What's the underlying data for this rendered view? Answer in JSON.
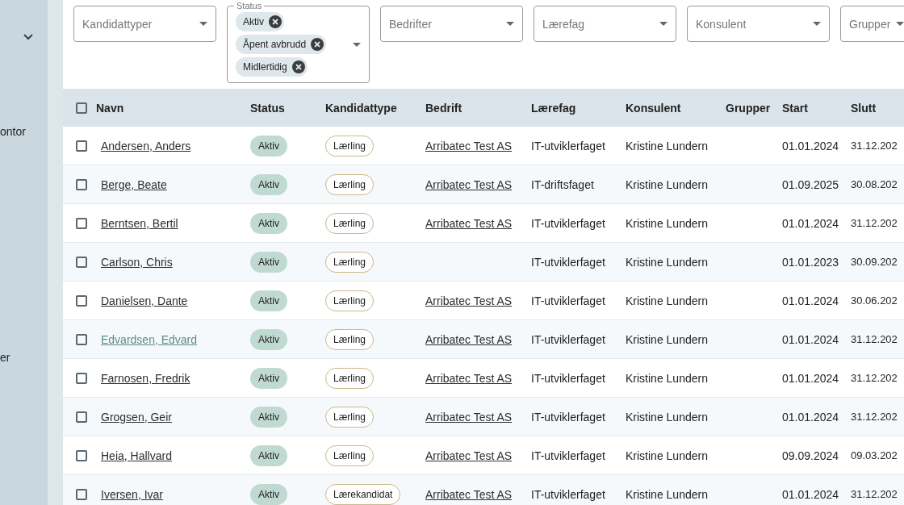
{
  "sidebar": {
    "items": [
      {
        "label": "ontor"
      },
      {
        "label": "er"
      }
    ]
  },
  "filters": [
    {
      "kind": "select",
      "placeholder": "Kandidattyper"
    },
    {
      "kind": "chips",
      "label": "Status",
      "chips": [
        "Aktiv",
        "Åpent avbrudd",
        "Midlertidig"
      ]
    },
    {
      "kind": "select",
      "placeholder": "Bedrifter"
    },
    {
      "kind": "select",
      "placeholder": "Lærefag"
    },
    {
      "kind": "select",
      "placeholder": "Konsulent"
    },
    {
      "kind": "select",
      "placeholder": "Grupper"
    }
  ],
  "table": {
    "select_all": {
      "checked": false
    },
    "columns": [
      "Navn",
      "Status",
      "Kandidattype",
      "Bedrift",
      "Lærefag",
      "Konsulent",
      "Grupper",
      "Start",
      "Slutt"
    ],
    "rows": [
      {
        "checked": false,
        "visited": false,
        "name": "Andersen, Anders",
        "status": "Aktiv",
        "type": "Lærling",
        "company": "Arribatec Test AS",
        "subject": "IT-utviklerfaget",
        "consultant": "Kristine Lundern",
        "start": "01.01.2024",
        "end": "31.12.202"
      },
      {
        "checked": false,
        "visited": false,
        "name": "Berge, Beate",
        "status": "Aktiv",
        "type": "Lærling",
        "company": "Arribatec Test AS",
        "subject": "IT-driftsfaget",
        "consultant": "Kristine Lundern",
        "start": "01.09.2025",
        "end": "30.08.202"
      },
      {
        "checked": false,
        "visited": false,
        "name": "Berntsen, Bertil",
        "status": "Aktiv",
        "type": "Lærling",
        "company": "Arribatec Test AS",
        "subject": "IT-utviklerfaget",
        "consultant": "Kristine Lundern",
        "start": "01.01.2024",
        "end": "31.12.202"
      },
      {
        "checked": false,
        "visited": false,
        "name": "Carlson, Chris",
        "status": "Aktiv",
        "type": "Lærling",
        "subject": "IT-utviklerfaget",
        "consultant": "Kristine Lundern",
        "start": "01.01.2023",
        "end": "30.09.202"
      },
      {
        "checked": false,
        "visited": false,
        "name": "Danielsen, Dante",
        "status": "Aktiv",
        "type": "Lærling",
        "company": "Arribatec Test AS",
        "subject": "IT-utviklerfaget",
        "consultant": "Kristine Lundern",
        "start": "01.01.2024",
        "end": "30.06.202"
      },
      {
        "checked": false,
        "visited": true,
        "name": "Edvardsen, Edvard",
        "status": "Aktiv",
        "type": "Lærling",
        "company": "Arribatec Test AS",
        "subject": "IT-utviklerfaget",
        "consultant": "Kristine Lundern",
        "start": "01.01.2024",
        "end": "31.12.202"
      },
      {
        "checked": false,
        "visited": false,
        "name": "Farnosen, Fredrik",
        "status": "Aktiv",
        "type": "Lærling",
        "company": "Arribatec Test AS",
        "subject": "IT-utviklerfaget",
        "consultant": "Kristine Lundern",
        "start": "01.01.2024",
        "end": "31.12.202"
      },
      {
        "checked": false,
        "visited": false,
        "name": "Grogsen, Geir",
        "status": "Aktiv",
        "type": "Lærling",
        "company": "Arribatec Test AS",
        "subject": "IT-utviklerfaget",
        "consultant": "Kristine Lundern",
        "start": "01.01.2024",
        "end": "31.12.202"
      },
      {
        "checked": false,
        "visited": false,
        "name": "Heia, Hallvard",
        "status": "Aktiv",
        "type": "Lærling",
        "company": "Arribatec Test AS",
        "subject": "IT-utviklerfaget",
        "consultant": "Kristine Lundern",
        "start": "09.09.2024",
        "end": "09.03.202"
      },
      {
        "checked": false,
        "visited": false,
        "name": "Iversen, Ivar",
        "status": "Aktiv",
        "type": "Lærekandidat",
        "company": "Arribatec Test AS",
        "subject": "IT-utviklerfaget",
        "consultant": "Kristine Lundern",
        "start": "01.01.2024",
        "end": "31.12.202"
      }
    ]
  }
}
